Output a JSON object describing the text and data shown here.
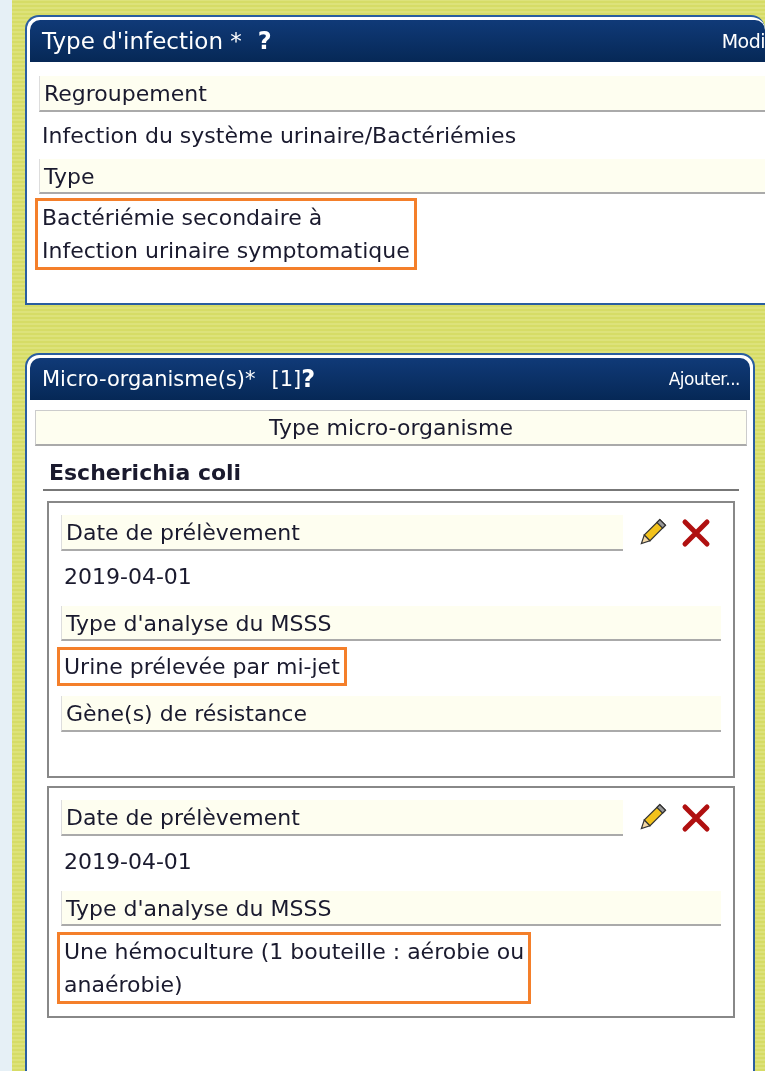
{
  "panels": [
    {
      "kind": "fields",
      "title": "Type d'infection *",
      "help": "?",
      "action": "Modi",
      "fields": [
        {
          "label": "Regroupement",
          "lines": [
            "Infection du système urinaire/Bactériémies"
          ]
        },
        {
          "label": "Type",
          "lines": [
            "Bactériémie secondaire à",
            "Infection urinaire symptomatique"
          ],
          "highlighted": true
        }
      ]
    },
    {
      "kind": "organisms",
      "title": "Micro-organisme(s)*",
      "count": "[1]",
      "help": "?",
      "action": "Ajouter...",
      "column_header": "Type micro-organisme",
      "organism": "Escherichia coli",
      "samples": [
        {
          "fields": [
            {
              "label": "Date de prélèvement",
              "lines": [
                "2019-04-01"
              ]
            },
            {
              "label": "Type d'analyse du MSSS",
              "lines": [
                "Urine prélevée par mi-jet"
              ],
              "highlighted": true
            },
            {
              "label": "Gène(s) de résistance"
            }
          ]
        },
        {
          "fields": [
            {
              "label": "Date de prélèvement",
              "lines": [
                "2019-04-01"
              ]
            },
            {
              "label": "Type d'analyse du MSSS",
              "lines": [
                "Une hémoculture (1 bouteille : aérobie ou",
                "anaérobie)"
              ],
              "highlighted": true
            }
          ]
        }
      ]
    }
  ]
}
